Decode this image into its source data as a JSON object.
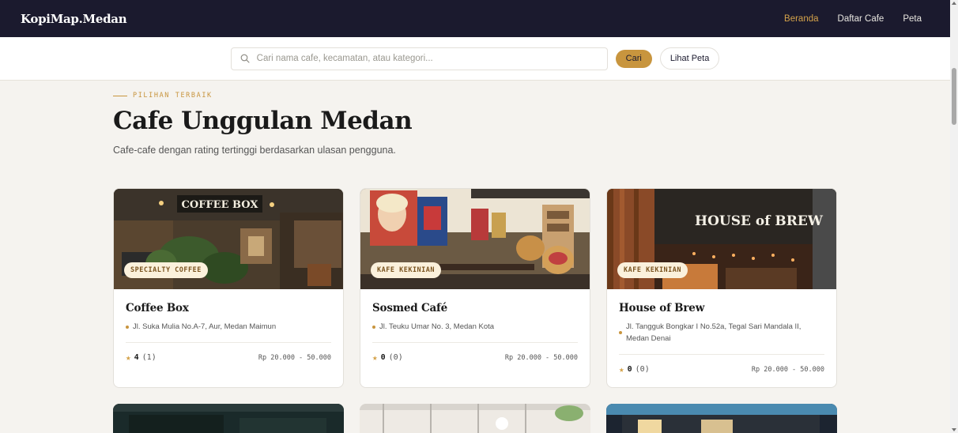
{
  "nav": {
    "logo": "KopiMap.Medan",
    "links": [
      "Beranda",
      "Daftar Cafe",
      "Peta"
    ]
  },
  "search": {
    "placeholder": "Cari nama cafe, kecamatan, atau kategori...",
    "button_label": "Cari",
    "map_button_label": "Lihat Peta"
  },
  "section": {
    "eyebrow": "PILIHAN TERBAIK",
    "title": "Cafe Unggulan Medan",
    "subtitle": "Cafe-cafe dengan rating tertinggi berdasarkan ulasan pengguna."
  },
  "cards": [
    {
      "category": "SPECIALTY COFFEE",
      "name": "Coffee Box",
      "address": "Jl. Suka Mulia No.A-7, Aur, Medan Maimun",
      "rating": "4",
      "rating_count": "(1)",
      "price": "Rp 20.000 - 50.000"
    },
    {
      "category": "KAFE KEKINIAN",
      "name": "Sosmed Café",
      "address": "Jl. Teuku Umar No. 3, Medan Kota",
      "rating": "0",
      "rating_count": "(0)",
      "price": "Rp 20.000 - 50.000"
    },
    {
      "category": "KAFE KEKINIAN",
      "name": "House of Brew",
      "address": "Jl. Tangguk Bongkar I No.52a, Tegal Sari Mandala II, Medan Denai",
      "rating": "0",
      "rating_count": "(0)",
      "price": "Rp 20.000 - 50.000"
    }
  ],
  "image_sign_texts": [
    "COFFEE BOX",
    "HOUSE of BREW"
  ],
  "colors": {
    "navbar_bg": "#1b1a2e",
    "accent": "#c8953e",
    "nav_active": "#d4a24a",
    "page_bg": "#f5f3ef",
    "badge_bg": "#fbf1dc"
  },
  "icons": {
    "search": "search-icon",
    "star": "star-icon",
    "location": "location-dot-icon"
  }
}
